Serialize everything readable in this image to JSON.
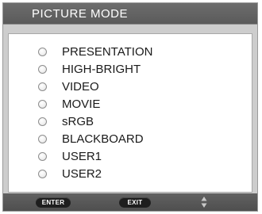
{
  "menu": {
    "title": "PICTURE MODE",
    "options": [
      {
        "label": "PRESENTATION",
        "selected": false
      },
      {
        "label": "HIGH-BRIGHT",
        "selected": false
      },
      {
        "label": "VIDEO",
        "selected": false
      },
      {
        "label": "MOVIE",
        "selected": false
      },
      {
        "label": "sRGB",
        "selected": false
      },
      {
        "label": "BLACKBOARD",
        "selected": false
      },
      {
        "label": "USER1",
        "selected": false
      },
      {
        "label": "USER2",
        "selected": false
      }
    ]
  },
  "footer": {
    "enter_label": "ENTER",
    "exit_label": "EXIT",
    "navigate_icon": "up-down-arrows-icon"
  },
  "colors": {
    "title_bar": "#5f5f5f",
    "menu_background": "#cdcdcd",
    "panel_background": "#ffffff",
    "footer_bar": "#555555"
  }
}
